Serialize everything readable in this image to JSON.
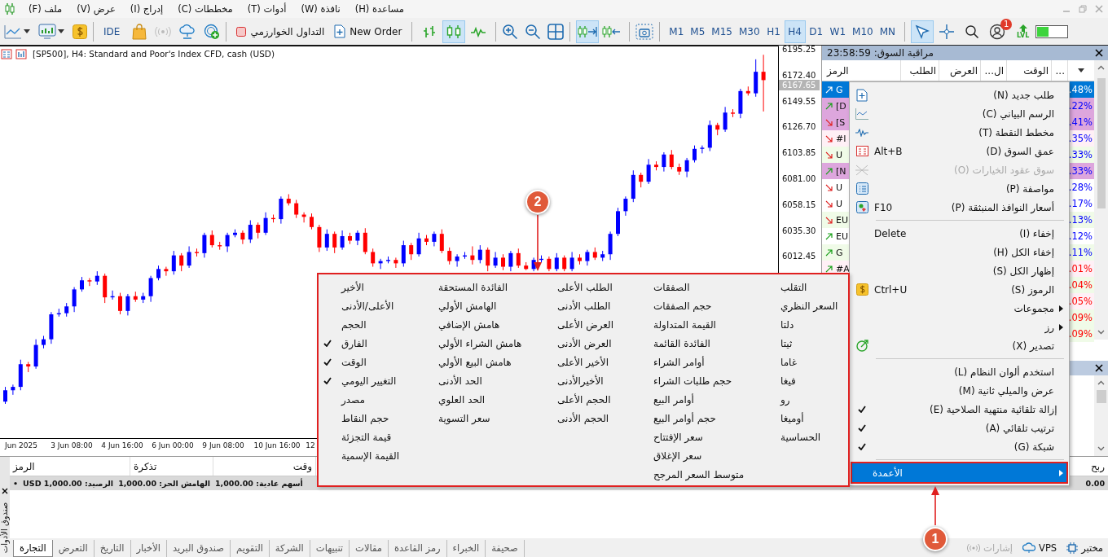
{
  "menu_bar": {
    "items": [
      "مساعدة (H)",
      "نافذة (W)",
      "أدوات (T)",
      "مخططات (C)",
      "إدراج (I)",
      "عرض (V)",
      "ملف (F)"
    ]
  },
  "toolbar": {
    "ide": "IDE",
    "algo_trading": "التداول الخوارزمي",
    "new_order": "New Order",
    "chart_types": [
      {
        "selected": false
      },
      {
        "selected": true
      },
      {
        "selected": false
      }
    ],
    "scroll_tools": [
      {
        "selected": true
      },
      {
        "selected": false
      }
    ],
    "timeframes": [
      {
        "label": "MN",
        "selected": false
      },
      {
        "label": "M10",
        "selected": false
      },
      {
        "label": "W1",
        "selected": false
      },
      {
        "label": "D1",
        "selected": false
      },
      {
        "label": "H4",
        "selected": true
      },
      {
        "label": "H1",
        "selected": false
      },
      {
        "label": "M30",
        "selected": false
      },
      {
        "label": "M15",
        "selected": false
      },
      {
        "label": "M5",
        "selected": false
      },
      {
        "label": "M1",
        "selected": false
      }
    ],
    "pointer_tools": [
      {
        "selected": true
      },
      {
        "selected": false
      }
    ],
    "notification_badge": "1",
    "lvl": "LVL"
  },
  "chart": {
    "title": "[SP500], H4:  Standard and Poor's Index CFD, cash (USD)",
    "current_price": "6167.65",
    "time_labels": [
      "12",
      "10 Jun 16:00",
      "9 Jun 08:00",
      "6 Jun 00:00",
      "4 Jun 16:00",
      "3 Jun 08:00",
      "Jun 2025"
    ],
    "chart_data": {
      "type": "candlestick",
      "yticks": [
        {
          "value": 6195.25,
          "label": "6195.25"
        },
        {
          "value": 6172.4,
          "label": "6172.40"
        },
        {
          "value": 6149.55,
          "label": "6149.55"
        },
        {
          "value": 6126.7,
          "label": "6126.70"
        },
        {
          "value": 6103.85,
          "label": "6103.85"
        },
        {
          "value": 6081,
          "label": "6081.00"
        },
        {
          "value": 6058.15,
          "label": "6058.15"
        },
        {
          "value": 6035.3,
          "label": "6035.30"
        },
        {
          "value": 6012.45,
          "label": "6012.45"
        }
      ],
      "ylim": [
        5851.8,
        6198.1
      ],
      "categories": [
        null,
        null,
        null,
        null,
        null,
        null,
        null,
        null,
        null,
        null,
        null,
        null,
        null,
        null,
        null,
        null,
        null,
        null,
        null,
        null,
        null,
        null,
        null,
        null,
        null,
        null,
        null,
        null,
        null,
        null,
        null,
        null,
        null,
        null,
        null,
        null,
        null,
        null,
        null,
        null,
        null,
        null,
        null,
        null,
        null,
        null,
        null,
        null,
        null,
        null,
        null,
        null,
        null,
        null,
        null,
        null,
        null,
        null,
        null,
        null,
        null,
        null,
        null,
        null,
        null,
        null,
        null,
        null,
        null,
        null,
        null,
        null,
        null,
        null,
        null,
        null,
        null,
        null,
        null,
        null,
        null,
        null,
        null,
        null,
        null,
        null,
        null,
        null,
        null,
        null,
        null,
        null,
        null,
        null,
        null,
        null,
        null,
        null,
        null,
        null
      ],
      "ohlc": [
        [
          5884,
          5897,
          5882,
          5894
        ],
        [
          5894,
          5899,
          5890,
          5897
        ],
        [
          5897,
          5921,
          5894,
          5917
        ],
        [
          5917,
          5919,
          5910,
          5915
        ],
        [
          5915,
          5939,
          5913,
          5934
        ],
        [
          5934,
          5942,
          5931,
          5939
        ],
        [
          5939,
          5963,
          5935,
          5961
        ],
        [
          5961,
          5966,
          5959,
          5962
        ],
        [
          5962,
          5971,
          5959,
          5968
        ],
        [
          5968,
          5985,
          5963,
          5983
        ],
        [
          5983,
          5994,
          5981,
          5991
        ],
        [
          5991,
          5993,
          5986,
          5990
        ],
        [
          5990,
          5999,
          5987,
          5995
        ],
        [
          5995,
          5997,
          5971,
          5976
        ],
        [
          5976,
          5982,
          5974,
          5977
        ],
        [
          5977,
          5980,
          5961,
          5964
        ],
        [
          5964,
          5979,
          5960,
          5977
        ],
        [
          5977,
          5981,
          5972,
          5974
        ],
        [
          5974,
          5980,
          5971,
          5977
        ],
        [
          5977,
          5995,
          5972,
          5993
        ],
        [
          5993,
          6004,
          5991,
          6001
        ],
        [
          6001,
          6003,
          5995,
          5999
        ],
        [
          5999,
          6017,
          5996,
          6013
        ],
        [
          6013,
          6015,
          5999,
          6004
        ],
        [
          6004,
          6021,
          6002,
          6016
        ],
        [
          6016,
          6019,
          6012,
          6015
        ],
        [
          6015,
          6033,
          6011,
          6031
        ],
        [
          6031,
          6035,
          6020,
          6022
        ],
        [
          6022,
          6025,
          6018,
          6021
        ],
        [
          6021,
          6033,
          6016,
          6031
        ],
        [
          6031,
          6036,
          6029,
          6033
        ],
        [
          6033,
          6035,
          6023,
          6027
        ],
        [
          6027,
          6044,
          6024,
          6040
        ],
        [
          6040,
          6042,
          6028,
          6033
        ],
        [
          6033,
          6051,
          6031,
          6046
        ],
        [
          6046,
          6049,
          6042,
          6045
        ],
        [
          6045,
          6065,
          6041,
          6063
        ],
        [
          6063,
          6067,
          6057,
          6059
        ],
        [
          6059,
          6062,
          6046,
          6049
        ],
        [
          6049,
          6051,
          6042,
          6047
        ],
        [
          6047,
          6050,
          6036,
          6038
        ],
        [
          6038,
          6040,
          6016,
          6020
        ],
        [
          6020,
          6036,
          6017,
          6032
        ],
        [
          6032,
          6034,
          6015,
          6020
        ],
        [
          6020,
          6035,
          6018,
          6030
        ],
        [
          6030,
          6033,
          6023,
          6026
        ],
        [
          6026,
          6035,
          6022,
          6033
        ],
        [
          6033,
          6037,
          6014,
          6016
        ],
        [
          6016,
          6019,
          6003,
          6006
        ],
        [
          6006,
          6010,
          6001,
          6008
        ],
        [
          6008,
          6012,
          6006,
          6009
        ],
        [
          6009,
          6011,
          6002,
          6006
        ],
        [
          6006,
          6026,
          6003,
          6022
        ],
        [
          6022,
          6024,
          6009,
          6014
        ],
        [
          6014,
          6033,
          6012,
          6028
        ],
        [
          6028,
          6031,
          6022,
          6025
        ],
        [
          6025,
          6034,
          6021,
          6032
        ],
        [
          6032,
          6036,
          6015,
          6017
        ],
        [
          6017,
          6020,
          6005,
          6008
        ],
        [
          6008,
          6014,
          6003,
          6012
        ],
        [
          6012,
          6016,
          6010,
          6013
        ],
        [
          6013,
          6021,
          6005,
          6009
        ],
        [
          6009,
          6022,
          6006,
          6018
        ],
        [
          6018,
          6020,
          5999,
          6004
        ],
        [
          6004,
          6016,
          6002,
          6011
        ],
        [
          6011,
          6014,
          6000,
          6003
        ],
        [
          6003,
          6017,
          5999,
          6015
        ],
        [
          6015,
          6019,
          6002,
          6004
        ],
        [
          6004,
          6007,
          6000,
          6001
        ],
        [
          6001,
          6011,
          5999,
          6009
        ],
        [
          6009,
          6013,
          6007,
          6010
        ],
        [
          6010,
          6012,
          5999,
          6001
        ],
        [
          6001,
          6015,
          5999,
          6011
        ],
        [
          6011,
          6013,
          5999,
          6001
        ],
        [
          6001,
          6016,
          5999,
          6011
        ],
        [
          6011,
          6014,
          6005,
          6008
        ],
        [
          6008,
          6018,
          6004,
          6016
        ],
        [
          6016,
          6020,
          6009,
          6011
        ],
        [
          6011,
          6017,
          6008,
          6014
        ],
        [
          6014,
          6034,
          6009,
          6032
        ],
        [
          6032,
          6055,
          6030,
          6052
        ],
        [
          6052,
          6065,
          6048,
          6063
        ],
        [
          6063,
          6088,
          6060,
          6084
        ],
        [
          6084,
          6086,
          6073,
          6078
        ],
        [
          6078,
          6098,
          6076,
          6093
        ],
        [
          6093,
          6096,
          6088,
          6091
        ],
        [
          6091,
          6104,
          6087,
          6102
        ],
        [
          6102,
          6106,
          6089,
          6091
        ],
        [
          6091,
          6094,
          6084,
          6087
        ],
        [
          6087,
          6099,
          6082,
          6097
        ],
        [
          6097,
          6110,
          6095,
          6107
        ],
        [
          6107,
          6110,
          6103,
          6108
        ],
        [
          6108,
          6132,
          6105,
          6128
        ],
        [
          6128,
          6130,
          6119,
          6124
        ],
        [
          6124,
          6144,
          6122,
          6139
        ],
        [
          6139,
          6142,
          6135,
          6138
        ],
        [
          6138,
          6160,
          6134,
          6158
        ],
        [
          6158,
          6162,
          6154,
          6156
        ],
        [
          6156,
          6186,
          6153,
          6175
        ],
        [
          6175,
          6190,
          6140,
          6167.65
        ]
      ]
    }
  },
  "market_watch": {
    "title": "مراقبة السوق: 23:58:59",
    "columns": [
      "...",
      "الوقت",
      "ال...",
      "العرض",
      "الطلب",
      "الرمز"
    ],
    "rows": [
      {
        "symbol": "G",
        "rising": true,
        "change": ".48%",
        "negative": false,
        "selected": true
      },
      {
        "symbol": "[D",
        "rising": true,
        "change": ".22%",
        "negative": false,
        "selected": false,
        "color": "#dda6dd"
      },
      {
        "symbol": "[S",
        "rising": false,
        "change": ".41%",
        "negative": false,
        "selected": false,
        "color": "#dda6dd"
      },
      {
        "symbol": "#I",
        "rising": false,
        "change": ".35%",
        "negative": false,
        "selected": false,
        "color": "#fff0f6"
      },
      {
        "symbol": "U",
        "rising": false,
        "change": ".33%",
        "negative": false,
        "selected": false,
        "color": "#f0fbe8"
      },
      {
        "symbol": "[N",
        "rising": true,
        "change": ".33%",
        "negative": false,
        "selected": false,
        "color": "#dda6dd"
      },
      {
        "symbol": "U",
        "rising": false,
        "change": ".28%",
        "negative": false,
        "selected": false,
        "color": "#ffffff"
      },
      {
        "symbol": "U",
        "rising": false,
        "change": ".17%",
        "negative": false,
        "selected": false,
        "color": "#ffffff"
      },
      {
        "symbol": "EU",
        "rising": false,
        "change": ".13%",
        "negative": false,
        "selected": false,
        "color": "#f0fbe8"
      },
      {
        "symbol": "EU",
        "rising": true,
        "change": ".12%",
        "negative": false,
        "selected": false,
        "color": "#ffffff"
      },
      {
        "symbol": "G",
        "rising": true,
        "change": ".11%",
        "negative": false,
        "selected": false,
        "color": "#f0fbe8"
      },
      {
        "symbol": "#A",
        "rising": true,
        "change": ".01%",
        "negative": true,
        "selected": false,
        "color": "#fff0f6"
      },
      {
        "change": ".04%",
        "negative": true,
        "selected": false,
        "color": "#f0fbe8"
      },
      {
        "change": ".05%",
        "negative": true,
        "selected": false,
        "color": "#fff0f6"
      },
      {
        "change": ".09%",
        "negative": true,
        "selected": false,
        "color": "#f0fbe8"
      },
      {
        "change": ".09%",
        "negative": true,
        "selected": false,
        "color": "#f0fbe8"
      }
    ]
  },
  "context_menu": {
    "items": [
      {
        "kind": "item",
        "label": "طلب جديد (N)",
        "checked": false,
        "disabled": false
      },
      {
        "kind": "item",
        "label": "الرسم البياني (C)",
        "checked": false,
        "disabled": false
      },
      {
        "kind": "item",
        "label": "مخطط النقطة (T)",
        "checked": false,
        "disabled": false
      },
      {
        "kind": "item",
        "label": "عمق السوق (D)",
        "shortcut": "Alt+B",
        "checked": false,
        "disabled": false
      },
      {
        "kind": "item",
        "label": "سوق عقود الخيارات (O)",
        "checked": false,
        "disabled": true
      },
      {
        "kind": "item",
        "label": "مواصفة (P)",
        "checked": false,
        "disabled": false
      },
      {
        "kind": "item",
        "label": "أسعار النوافذ المنبثقة (P)",
        "shortcut": "F10",
        "checked": false,
        "disabled": false
      },
      {
        "kind": "separator"
      },
      {
        "kind": "item",
        "label": "إخفاء (I)",
        "shortcut": "Delete",
        "checked": false,
        "disabled": false
      },
      {
        "kind": "item",
        "label": "إخفاء الكل (H)",
        "checked": false,
        "disabled": false
      },
      {
        "kind": "item",
        "label": "إظهار الكل (S)",
        "checked": false,
        "disabled": false
      },
      {
        "kind": "item",
        "label": "الرموز (S)",
        "shortcut": "Ctrl+U",
        "checked": false,
        "disabled": false
      },
      {
        "kind": "submenu",
        "label": "مجموعات",
        "selected": false
      },
      {
        "kind": "submenu",
        "label": "رز",
        "selected": false
      },
      {
        "kind": "item",
        "label": "تصدير (X)",
        "checked": false,
        "disabled": false
      },
      {
        "kind": "separator"
      },
      {
        "kind": "item",
        "label": "استخدم ألوان النظام (L)",
        "checked": false,
        "disabled": false
      },
      {
        "kind": "item",
        "label": "عرض والميلي ثانية (M)",
        "checked": false,
        "disabled": false
      },
      {
        "kind": "item",
        "label": "إزالة تلقائية منتهية الصلاحية (E)",
        "checked": true,
        "disabled": false
      },
      {
        "kind": "item",
        "label": "ترتيب تلقائي (A)",
        "checked": true,
        "disabled": false
      },
      {
        "kind": "item",
        "label": "شبكة (G)",
        "checked": true,
        "disabled": false
      },
      {
        "kind": "separator"
      },
      {
        "kind": "submenu",
        "label": "الأعمدة",
        "selected": true
      }
    ]
  },
  "columns_submenu": {
    "columns": [
      [
        {
          "label": "التقلب",
          "checked": false
        },
        {
          "label": "السعر النظري",
          "checked": false
        },
        {
          "label": "دلتا",
          "checked": false
        },
        {
          "label": "ثيتا",
          "checked": false
        },
        {
          "label": "غاما",
          "checked": false
        },
        {
          "label": "فيغا",
          "checked": false
        },
        {
          "label": "رو",
          "checked": false
        },
        {
          "label": "أوميغا",
          "checked": false
        },
        {
          "label": "الحساسية",
          "checked": false
        }
      ],
      [
        {
          "label": "الصفقات",
          "checked": false
        },
        {
          "label": "حجم الصفقات",
          "checked": false
        },
        {
          "label": "القيمة المتداولة",
          "checked": false
        },
        {
          "label": "الفائدة القائمة",
          "checked": false
        },
        {
          "label": "أوامر الشراء",
          "checked": false
        },
        {
          "label": "حجم طلبات الشراء",
          "checked": false
        },
        {
          "label": "أوامر البيع",
          "checked": false
        },
        {
          "label": "حجم أوامر البيع",
          "checked": false
        },
        {
          "label": "سعر الإفتتاح",
          "checked": false
        },
        {
          "label": "سعر الإغلاق",
          "checked": false
        },
        {
          "label": "متوسط السعر المرجح",
          "checked": false
        }
      ],
      [
        {
          "label": "الطلب الأعلى",
          "checked": false
        },
        {
          "label": "الطلب الأدنى",
          "checked": false
        },
        {
          "label": "العرض الأعلى",
          "checked": false
        },
        {
          "label": "العرض الأدنى",
          "checked": false
        },
        {
          "label": "الأخير الأعلى",
          "checked": false
        },
        {
          "label": "الأخيرالأدنى",
          "checked": false
        },
        {
          "label": "الحجم الأعلى",
          "checked": false
        },
        {
          "label": "الحجم الأدنى",
          "checked": false
        }
      ],
      [
        {
          "label": "الفائدة المستحقة",
          "checked": false
        },
        {
          "label": "الهامش الأولي",
          "checked": false
        },
        {
          "label": "هامش الإضافي",
          "checked": false
        },
        {
          "label": "هامش الشراء الأولي",
          "checked": false
        },
        {
          "label": "هامش البيع الأولي",
          "checked": false
        },
        {
          "label": "الحد الأدنى",
          "checked": false
        },
        {
          "label": "الحد العلوي",
          "checked": false
        },
        {
          "label": "سعر التسوية",
          "checked": false
        }
      ],
      [
        {
          "label": "الأخير",
          "checked": false
        },
        {
          "label": "الأعلى/الأدنى",
          "checked": false
        },
        {
          "label": "الحجم",
          "checked": false
        },
        {
          "label": "الفارق",
          "checked": true
        },
        {
          "label": "الوقت",
          "checked": true
        },
        {
          "label": "التغيير اليومي",
          "checked": true
        },
        {
          "label": "مصدر",
          "checked": false
        },
        {
          "label": "حجم النقاط",
          "checked": false
        },
        {
          "label": "قيمة التجزئة",
          "checked": false
        },
        {
          "label": "القيمة الإسمية",
          "checked": false
        }
      ]
    ]
  },
  "toolbox": {
    "side_label": "صندوق الأدوات",
    "columns": [
      "ربح",
      "وقت",
      "تذكرة",
      "الرمز"
    ],
    "summary": {
      "bullet": "•",
      "balance": "الرصيد: 1,000.00 USD",
      "free_margin": "الهامش الحر: 1,000.00",
      "equity": "أسهم عادية: 1,000.00",
      "profit": "0.00"
    },
    "tabs": [
      {
        "label": "صحيفة",
        "selected": false
      },
      {
        "label": "الخبراء",
        "selected": false
      },
      {
        "label": "رمز القاعدة",
        "selected": false
      },
      {
        "label": "مقالات",
        "selected": false
      },
      {
        "label": "تنبيهات",
        "selected": false
      },
      {
        "label": "الشركة",
        "selected": false
      },
      {
        "label": "التقويم",
        "selected": false
      },
      {
        "label": "صندوق البريد",
        "selected": false
      },
      {
        "label": "الأخبار",
        "selected": false
      },
      {
        "label": "التاريخ",
        "selected": false
      },
      {
        "label": "التعرض",
        "selected": false
      },
      {
        "label": "التجارة",
        "selected": true
      }
    ],
    "status": [
      {
        "label": "مختبر",
        "disabled": false
      },
      {
        "label": "VPS",
        "disabled": false
      },
      {
        "label": "إشارات",
        "disabled": true
      }
    ]
  },
  "callouts": [
    {
      "number": "2"
    },
    {
      "number": "1"
    }
  ]
}
